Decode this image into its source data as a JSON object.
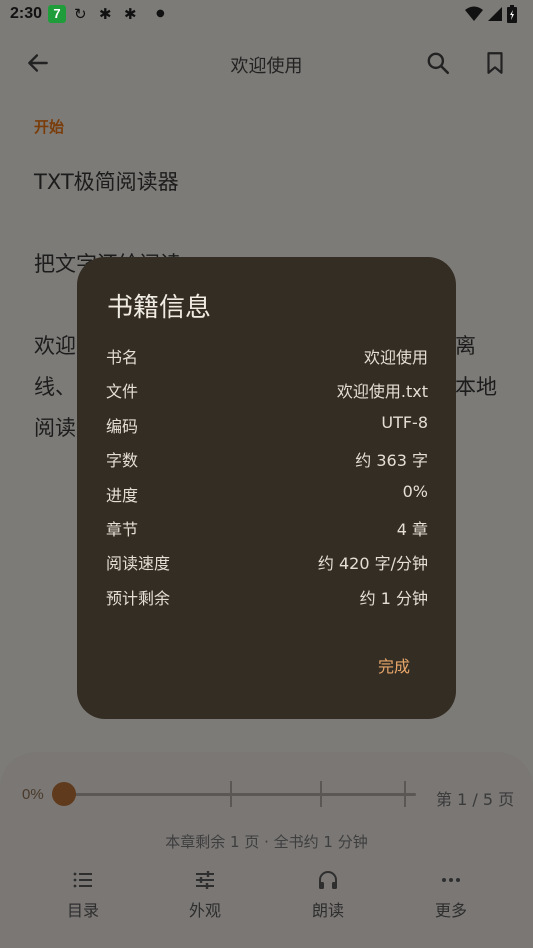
{
  "status_bar": {
    "time": "2:30",
    "badge": "7"
  },
  "app_bar": {
    "title": "欢迎使用"
  },
  "reader": {
    "chapter": "开始",
    "line1": "TXT极简阅读器",
    "line2": "把文字还给阅读",
    "line3_left": "欢迎",
    "line3_right": "离",
    "line4_left": "线、",
    "line4_right": "本地",
    "line5_left": "阅读"
  },
  "dialog": {
    "title": "书籍信息",
    "rows": [
      {
        "key": "书名",
        "value": "欢迎使用"
      },
      {
        "key": "文件",
        "value": "欢迎使用.txt"
      },
      {
        "key": "编码",
        "value": "UTF-8"
      },
      {
        "key": "字数",
        "value": "约 363 字"
      },
      {
        "key": "进度",
        "value": "0%"
      },
      {
        "key": "章节",
        "value": "4 章"
      },
      {
        "key": "阅读速度",
        "value": "约 420 字/分钟"
      },
      {
        "key": "预计剩余",
        "value": "约 1 分钟"
      }
    ],
    "done": "完成"
  },
  "bottom": {
    "progress_label": "0%",
    "progress": 0,
    "page_count": "第 1 / 5 页",
    "remain": "本章剩余 1 页 · 全书约 1 分钟",
    "nav": [
      {
        "label": "目录",
        "icon": "list-icon"
      },
      {
        "label": "外观",
        "icon": "sliders-icon"
      },
      {
        "label": "朗读",
        "icon": "headphones-icon"
      },
      {
        "label": "更多",
        "icon": "more-icon"
      }
    ]
  },
  "colors": {
    "dialog_bg": "#342d23",
    "accent": "#e8a76a",
    "chapter": "#7a3d0a",
    "thumb": "#5f3a1c"
  }
}
